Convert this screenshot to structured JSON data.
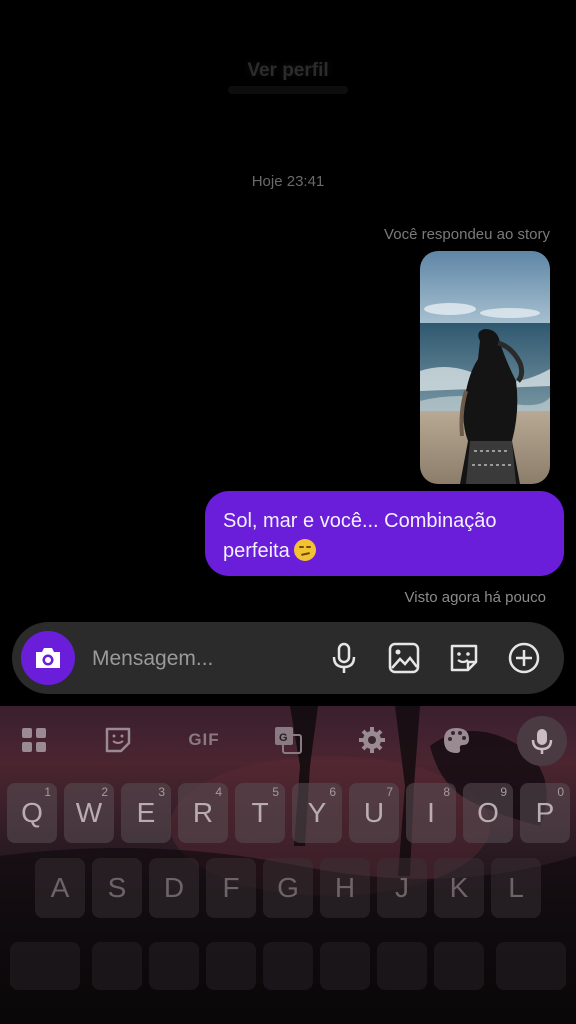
{
  "header": {
    "profile_link": "Ver perfil"
  },
  "chat": {
    "timestamp": "Hoje 23:41",
    "replied_label": "Você respondeu ao story",
    "message_text": "Sol, mar e você... Combinação perfeita",
    "seen_label": "Visto agora há pouco"
  },
  "composer": {
    "placeholder": "Mensagem...",
    "icons": [
      "camera-icon",
      "microphone-icon",
      "image-icon",
      "sticker-icon",
      "plus-circle-icon"
    ],
    "accent_color": "#6a1ed9"
  },
  "keyboard": {
    "toolbar": {
      "gif_label": "GIF"
    },
    "row1": [
      {
        "key": "Q",
        "hint": "1"
      },
      {
        "key": "W",
        "hint": "2"
      },
      {
        "key": "E",
        "hint": "3"
      },
      {
        "key": "R",
        "hint": "4"
      },
      {
        "key": "T",
        "hint": "5"
      },
      {
        "key": "Y",
        "hint": "6"
      },
      {
        "key": "U",
        "hint": "7"
      },
      {
        "key": "I",
        "hint": "8"
      },
      {
        "key": "O",
        "hint": "9"
      },
      {
        "key": "P",
        "hint": "0"
      }
    ],
    "row2": [
      "A",
      "S",
      "D",
      "F",
      "G",
      "H",
      "J",
      "K",
      "L"
    ]
  }
}
